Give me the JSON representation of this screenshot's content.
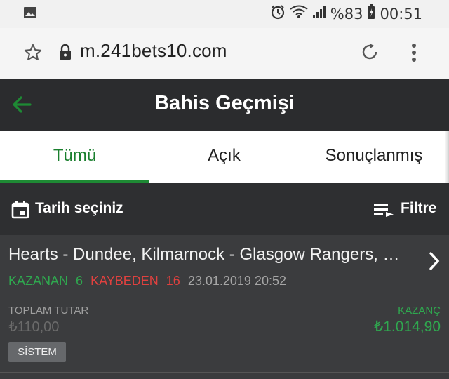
{
  "status": {
    "battery": "%83",
    "time": "00:51",
    "icons": [
      "image-icon",
      "alarm-icon",
      "wifi-icon",
      "signal-icon",
      "battery-icon"
    ]
  },
  "browser": {
    "url": "m.241bets10.com",
    "icons": [
      "star-icon",
      "lock-icon",
      "reload-icon",
      "more-vert-icon"
    ]
  },
  "header": {
    "title": "Bahis Geçmişi",
    "back_icon": "arrow-left-icon"
  },
  "tabs": [
    {
      "label": "Tümü",
      "active": true
    },
    {
      "label": "Açık",
      "active": false
    },
    {
      "label": "Sonuçlanmış",
      "active": false
    }
  ],
  "filterbar": {
    "date_label": "Tarih seçiniz",
    "filter_label": "Filtre"
  },
  "bet": {
    "title": "Hearts - Dundee, Kilmarnock - Glasgow Rangers, Falkirk - Hibernian",
    "won_label": "KAZANAN",
    "won_count": "6",
    "lost_label": "KAYBEDEN",
    "lost_count": "16",
    "date": "23.01.2019 20:52",
    "total_label": "TOPLAM TUTAR",
    "total_value": "₺110,00",
    "win_label": "KAZANÇ",
    "win_value": "₺1.014,90",
    "type_badge": "SİSTEM"
  },
  "colors": {
    "accent_green": "#1e8a34",
    "win_green": "#2fa84f",
    "lose_red": "#e0413f",
    "appbar": "#2b2c2e"
  }
}
